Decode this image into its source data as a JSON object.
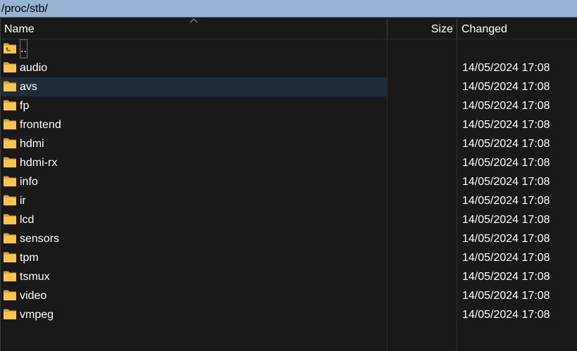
{
  "path_bar": {
    "path": "/proc/stb/"
  },
  "columns": {
    "name": "Name",
    "size": "Size",
    "changed": "Changed"
  },
  "colors": {
    "path_bar_bg": "#96b3d3",
    "panel_bg": "#191919",
    "selected_row_bg": "#1f2b38",
    "folder_icon": "#f8c54e"
  },
  "files": [
    {
      "name": "..",
      "size": "",
      "changed": "",
      "icon": "parent-folder-icon",
      "selected": false
    },
    {
      "name": "audio",
      "size": "",
      "changed": "14/05/2024 17:08",
      "icon": "folder-icon",
      "selected": false
    },
    {
      "name": "avs",
      "size": "",
      "changed": "14/05/2024 17:08",
      "icon": "folder-icon",
      "selected": true
    },
    {
      "name": "fp",
      "size": "",
      "changed": "14/05/2024 17:08",
      "icon": "folder-icon",
      "selected": false
    },
    {
      "name": "frontend",
      "size": "",
      "changed": "14/05/2024 17:08",
      "icon": "folder-icon",
      "selected": false
    },
    {
      "name": "hdmi",
      "size": "",
      "changed": "14/05/2024 17:08",
      "icon": "folder-icon",
      "selected": false
    },
    {
      "name": "hdmi-rx",
      "size": "",
      "changed": "14/05/2024 17:08",
      "icon": "folder-icon",
      "selected": false
    },
    {
      "name": "info",
      "size": "",
      "changed": "14/05/2024 17:08",
      "icon": "folder-icon",
      "selected": false
    },
    {
      "name": "ir",
      "size": "",
      "changed": "14/05/2024 17:08",
      "icon": "folder-icon",
      "selected": false
    },
    {
      "name": "lcd",
      "size": "",
      "changed": "14/05/2024 17:08",
      "icon": "folder-icon",
      "selected": false
    },
    {
      "name": "sensors",
      "size": "",
      "changed": "14/05/2024 17:08",
      "icon": "folder-icon",
      "selected": false
    },
    {
      "name": "tpm",
      "size": "",
      "changed": "14/05/2024 17:08",
      "icon": "folder-icon",
      "selected": false
    },
    {
      "name": "tsmux",
      "size": "",
      "changed": "14/05/2024 17:08",
      "icon": "folder-icon",
      "selected": false
    },
    {
      "name": "video",
      "size": "",
      "changed": "14/05/2024 17:08",
      "icon": "folder-icon",
      "selected": false
    },
    {
      "name": "vmpeg",
      "size": "",
      "changed": "14/05/2024 17:08",
      "icon": "folder-icon",
      "selected": false
    }
  ]
}
